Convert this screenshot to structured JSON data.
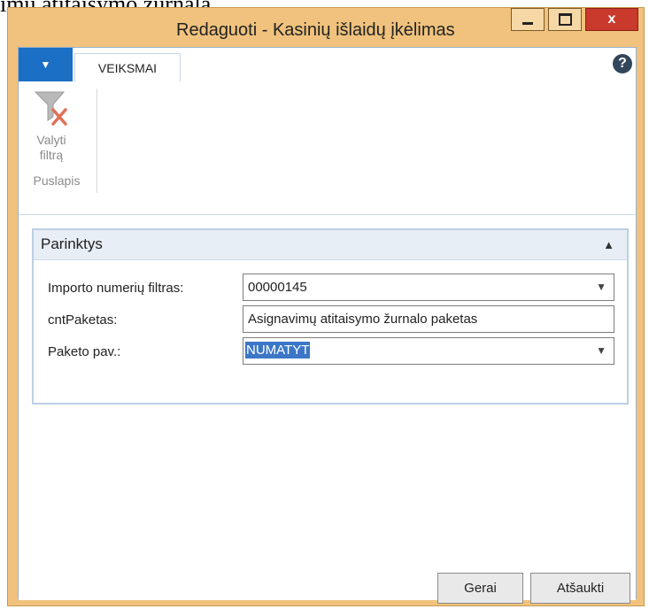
{
  "background": {
    "text": "imų atitaisymo žurnalą."
  },
  "window": {
    "title": "Redaguoti - Kasinių išlaidų įkėlimas",
    "close_label": "x"
  },
  "ribbon": {
    "tab_actions": "VEIKSMAI",
    "help_label": "?",
    "clear_filter_label_line1": "Valyti",
    "clear_filter_label_line2": "filtrą",
    "group_label": "Puslapis"
  },
  "fasttab": {
    "title": "Parinktys",
    "fields": [
      {
        "label": "Importo numerių filtras:",
        "value": "00000145",
        "has_dropdown": true
      },
      {
        "label": "cntPaketas:",
        "value": "Asignavimų atitaisymo žurnalo paketas",
        "has_dropdown": false
      },
      {
        "label": "Paketo pav.:",
        "value": "NUMATYT",
        "has_dropdown": true
      }
    ]
  },
  "buttons": {
    "ok": "Gerai",
    "cancel": "Atšaukti"
  },
  "colors": {
    "titlebar": "#f0c27d",
    "menu_button": "#1b6fc4",
    "close_button": "#c93a2c",
    "selection": "#3b77c6"
  },
  "icons": {
    "clear_filter": "funnel-with-red-x-icon",
    "help": "question-circle-icon"
  }
}
